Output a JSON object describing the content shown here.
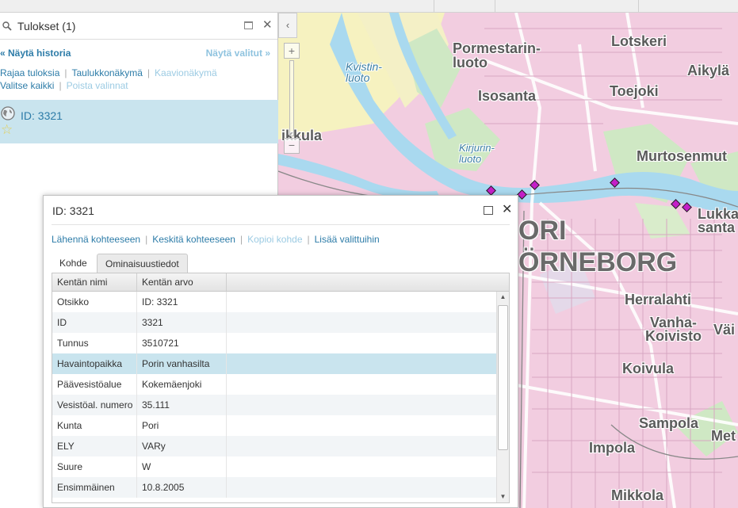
{
  "results_panel": {
    "title": "Tulokset (1)",
    "show_history": "Näytä historia",
    "show_selected": "Näytä valitut",
    "links_row1": [
      "Rajaa tuloksia",
      "Taulukkonäkymä",
      "Kaavionäkymä"
    ],
    "links_row2": [
      "Valitse kaikki",
      "Poista valinnat"
    ],
    "item": {
      "label": "ID: 3321",
      "icon": "globe-icon",
      "star": "star-icon"
    }
  },
  "popup": {
    "title": "ID: 3321",
    "actions": [
      "Lähennä kohteeseen",
      "Keskitä kohteeseen",
      "Kopioi kohde",
      "Lisää valittuihin"
    ],
    "tabs": [
      "Kohde",
      "Ominaisuustiedot"
    ],
    "active_tab": "Ominaisuustiedot",
    "columns": [
      "Kentän nimi",
      "Kentän arvo"
    ],
    "rows": [
      {
        "name": "Otsikko",
        "value": "ID: 3321"
      },
      {
        "name": "ID",
        "value": "3321"
      },
      {
        "name": "Tunnus",
        "value": "3510721"
      },
      {
        "name": "Havaintopaikka",
        "value": "Porin vanhasilta"
      },
      {
        "name": "Päävesistöalue",
        "value": "Kokemäenjoki"
      },
      {
        "name": "Vesistöal. numero",
        "value": "35.111"
      },
      {
        "name": "Kunta",
        "value": "Pori"
      },
      {
        "name": "ELY",
        "value": "VARy"
      },
      {
        "name": "Suure",
        "value": "W"
      },
      {
        "name": "Ensimmäinen",
        "value": "10.8.2005"
      }
    ],
    "highlighted_row": "Havaintopaikka"
  },
  "map": {
    "labels": {
      "pormestarinluoto": "Pormestarin-\nluoto",
      "lotskeri": "Lotskeri",
      "aikyla": "Aikylä",
      "isosanta": "Isosanta",
      "toejoki": "Toejoki",
      "kvistinluoto": "Kvistin-\nluoto",
      "kirjurinluoto": "Kirjurin-\nluoto",
      "ikkula": "ikkula",
      "murtosenmutka": "Murtosenmut",
      "pori": "ORI",
      "bjorneborg": "ÖRNEBORG",
      "lukkarinsanta": "Lukka\nsanta",
      "herralahti": "Herralahti",
      "vanhakoivisto": "Vanha-\nKoivisto",
      "vai": "Väi",
      "koivula": "Koivula",
      "sampola": "Sampola",
      "met": "Met",
      "impola": "Impola",
      "mikkola": "Mikkola"
    },
    "colors": {
      "urban": "#f2cde0",
      "water": "#a9d9ef",
      "green": "#cfe8c4",
      "yellow": "#f6f2c0",
      "marker": "#c41fc8"
    }
  }
}
